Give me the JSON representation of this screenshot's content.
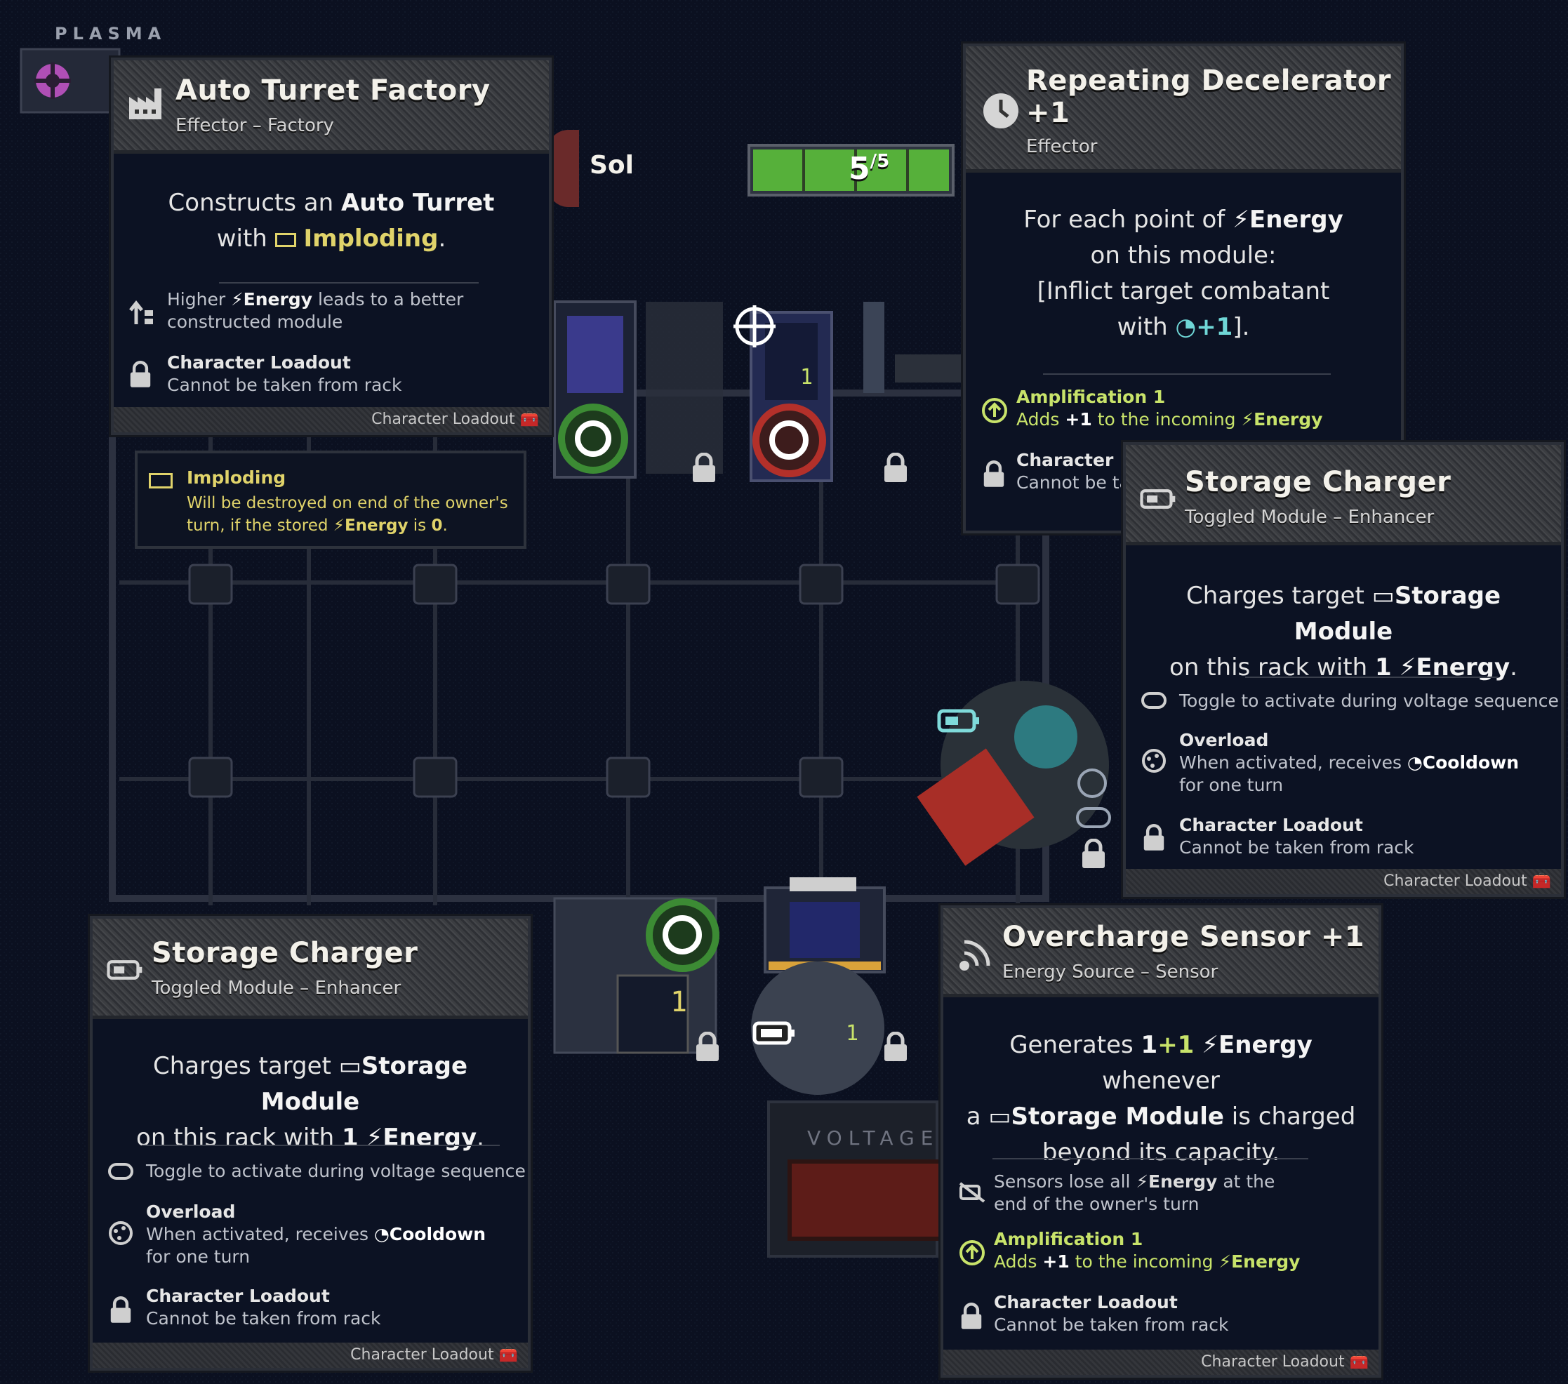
{
  "hud": {
    "plasma_label": "PLASMA",
    "player_name": "Sol",
    "energy_current": "5",
    "energy_max": "/5",
    "energy_fill": 1.0,
    "voltage_label": "VOLTAGE"
  },
  "cards": {
    "auto_turret": {
      "title": "Auto Turret Factory",
      "subtitle": "Effector – Factory",
      "desc_a": "Constructs an",
      "desc_b": "Auto Turret",
      "desc_c": "with",
      "desc_d": "Imploding",
      "desc_e": ".",
      "row1_a": "Higher",
      "row1_b": "Energy",
      "row1_c": "leads to a better",
      "row1_d": "constructed module",
      "row2_title": "Character Loadout",
      "row2_text": "Cannot be taken from rack",
      "footer": "Character Loadout"
    },
    "imploding_tip": {
      "title": "Imploding",
      "text_a": "Will be destroyed on end of the owner's",
      "text_b": "turn, if the stored",
      "text_c": "Energy",
      "text_d": "is",
      "text_e": "0",
      "text_f": "."
    },
    "decelerator": {
      "title_a": "Repeating Decelerator",
      "title_b": "+1",
      "subtitle": "Effector",
      "desc_a": "For each point of",
      "desc_b": "Energy",
      "desc_c": "on this module:",
      "desc_d": "[Inflict target combatant",
      "desc_e": "with",
      "desc_f": "+1",
      "desc_g": "].",
      "amp_title": "Amplification 1",
      "amp_a": "Adds",
      "amp_b": "+1",
      "amp_c": "to the incoming",
      "amp_d": "Energy",
      "row2_title": "Character Lo",
      "row2_text": "Cannot be ta"
    },
    "storage_right": {
      "title": "Storage Charger",
      "subtitle": "Toggled Module – Enhancer",
      "desc_a": "Charges target",
      "desc_b": "Storage Module",
      "desc_c": "on this rack with",
      "desc_d": "1",
      "desc_e": "Energy",
      "desc_f": ".",
      "toggle_text": "Toggle to activate during voltage sequence",
      "overload_title": "Overload",
      "overload_a": "When activated, receives",
      "overload_b": "Cooldown",
      "overload_c": "for one turn",
      "row_title": "Character Loadout",
      "row_text": "Cannot be taken from rack",
      "footer": "Character Loadout"
    },
    "storage_left": {
      "title": "Storage Charger",
      "subtitle": "Toggled Module – Enhancer",
      "desc_a": "Charges target",
      "desc_b": "Storage Module",
      "desc_c": "on this rack with",
      "desc_d": "1",
      "desc_e": "Energy",
      "desc_f": ".",
      "toggle_text": "Toggle to activate during voltage sequence",
      "overload_title": "Overload",
      "overload_a": "When activated, receives",
      "overload_b": "Cooldown",
      "overload_c": "for one turn",
      "row_title": "Character Loadout",
      "row_text": "Cannot be taken from rack",
      "footer": "Character Loadout"
    },
    "overcharge": {
      "title": "Overcharge Sensor +1",
      "subtitle": "Energy Source – Sensor",
      "desc_a": "Generates",
      "desc_b": "1",
      "desc_c": "+1",
      "desc_d": "Energy",
      "desc_e": "whenever",
      "desc_f": "a",
      "desc_g": "Storage Module",
      "desc_h": "is charged",
      "desc_i": "beyond its capacity.",
      "sensor_a": "Sensors lose all",
      "sensor_b": "Energy",
      "sensor_c": "at the",
      "sensor_d": "end of the owner's turn",
      "amp_title": "Amplification 1",
      "amp_a": "Adds",
      "amp_b": "+1",
      "amp_c": "to the incoming",
      "amp_d": "Energy",
      "row_title": "Character Loadout",
      "row_text": "Cannot be taken from rack",
      "footer": "Character Loadout"
    }
  },
  "modules": {
    "turret_factory_counter": "1",
    "decelerator_counter": "1",
    "storage_counter": "1",
    "sensor_counter": "1"
  },
  "colors": {
    "energy_green": "#56b03a",
    "accent_yellow": "#e0d36a",
    "amp_green": "#c8e36a",
    "cooldown_teal": "#6fd6d6",
    "plasma_purple": "#b04fb6",
    "switch_red": "#b3302a"
  },
  "icons": [
    "plasma-icon",
    "factory-icon",
    "clock-icon",
    "battery-icon",
    "signal-icon",
    "lock-icon",
    "bolt-icon",
    "toggle-icon",
    "cooldown-icon",
    "amplification-icon",
    "upgrade-arrows-icon",
    "toolbox-icon",
    "imploding-icon",
    "no-signal-icon"
  ]
}
